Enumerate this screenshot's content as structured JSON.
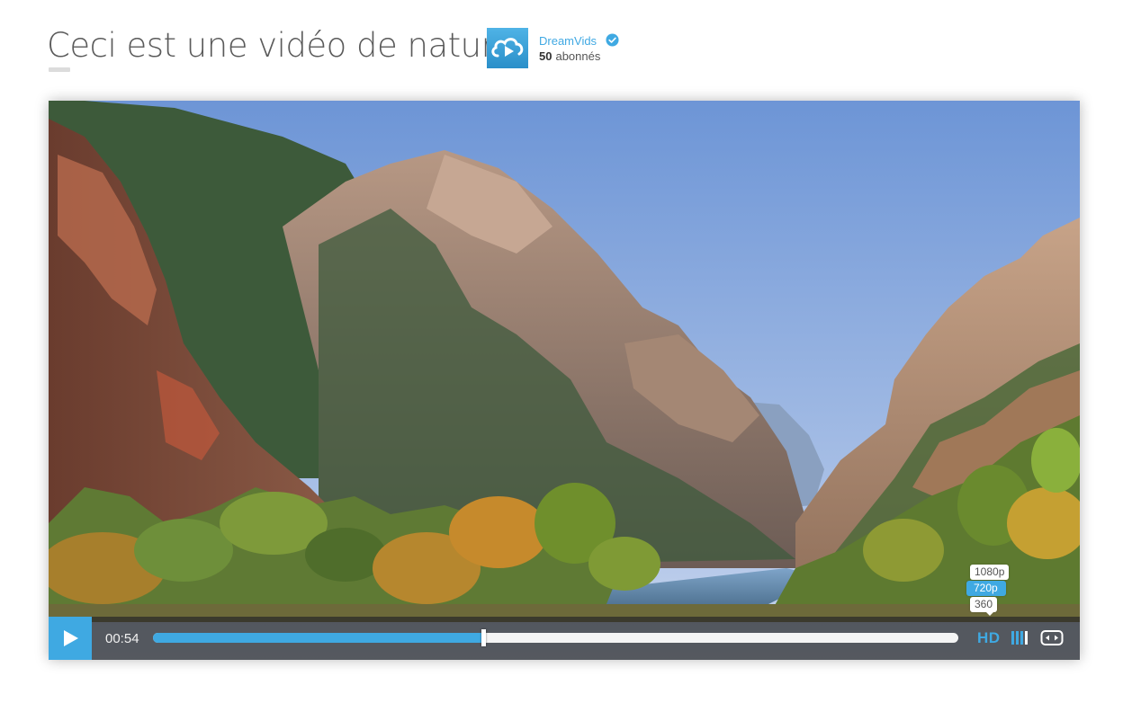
{
  "header": {
    "title": "Ceci est une vidéo de nature",
    "channel_name": "DreamVids",
    "subscriber_count": "50",
    "subscriber_label": "abonnés"
  },
  "player": {
    "current_time": "00:54",
    "progress": 0.41,
    "hd_label": "HD",
    "quality_options": [
      "1080p",
      "720p",
      "360"
    ],
    "selected_quality": "720p"
  },
  "colors": {
    "accent": "#3fa9e2",
    "title": "#5a5a5a",
    "control_bar": "#282828"
  },
  "icons": {
    "logo": "cloud-play-icon",
    "verified": "verified-check-icon",
    "play": "play-icon",
    "volume": "volume-bars-icon",
    "fullscreen": "fullscreen-icon"
  }
}
